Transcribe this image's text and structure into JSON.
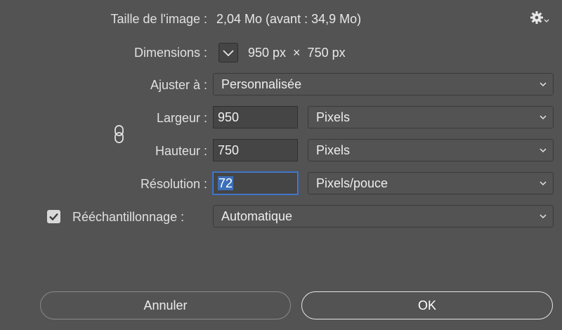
{
  "header": {
    "size_label": "Taille de l'image :",
    "size_value": "2,04 Mo (avant : 34,9 Mo)",
    "settings_icon": "gear-icon"
  },
  "dimensions": {
    "label": "Dimensions :",
    "value": "950 px  ×  750 px",
    "toggle_icon": "chevron-down-icon"
  },
  "fit": {
    "label": "Ajuster à :",
    "selected": "Personnalisée"
  },
  "width": {
    "label": "Largeur :",
    "value": "950",
    "unit": "Pixels"
  },
  "height": {
    "label": "Hauteur :",
    "value": "750",
    "unit": "Pixels"
  },
  "link_icon": "chain-link-icon",
  "resolution": {
    "label": "Résolution :",
    "value": "72",
    "unit": "Pixels/pouce"
  },
  "resample": {
    "label": "Rééchantillonnage :",
    "checked": true,
    "selected": "Automatique"
  },
  "buttons": {
    "cancel": "Annuler",
    "ok": "OK"
  },
  "colors": {
    "background": "#535353",
    "focus": "#4a7fd0",
    "selection": "#3d6fb8"
  }
}
